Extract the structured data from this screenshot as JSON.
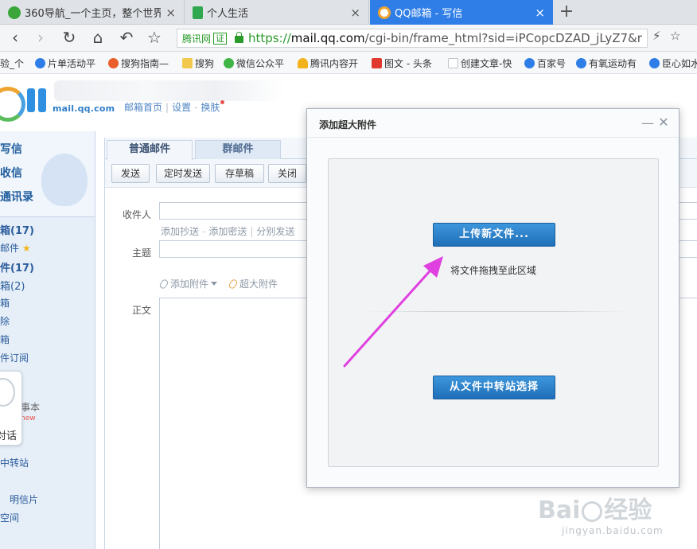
{
  "browser": {
    "tabs": [
      {
        "title": "360导航_一个主页，整个世界",
        "active": false,
        "icon": "360-browser-icon",
        "color": "#3aa53a"
      },
      {
        "title": "个人生活",
        "active": false,
        "icon": "sheet-icon",
        "color": "#2fa84f"
      },
      {
        "title": "QQ邮箱 - 写信",
        "active": true,
        "icon": "qq-mail-icon",
        "color": "#ffffff"
      }
    ],
    "close_glyph": "×",
    "new_tab_glyph": "+",
    "nav": {
      "back": "‹",
      "forward": "›",
      "reload": "↻",
      "home": "⌂",
      "undo": "↶",
      "favorite": "☆"
    },
    "address": {
      "site_tag": "腾讯网",
      "cert_badge": "证",
      "url_scheme": "https://",
      "url_host": "mail.qq.com",
      "url_path": "/cgi-bin/frame_html?sid=iPCopcDZAD_jLyZ7&r"
    },
    "right_icons": {
      "lightning": "⚡",
      "star": "☆"
    },
    "bookmarks": [
      {
        "label": "验_个",
        "icon": "none"
      },
      {
        "label": "片单活动平",
        "icon": "paw-icon",
        "color": "#2f7ee8"
      },
      {
        "label": "搜狗指南—",
        "icon": "sogou-icon",
        "color": "#e85d2a"
      },
      {
        "label": "搜狗",
        "icon": "folder-icon",
        "color": "#f2c94c"
      },
      {
        "label": "微信公众平",
        "icon": "wechat-icon",
        "color": "#3fb545"
      },
      {
        "label": "腾讯内容开",
        "icon": "bell-icon",
        "color": "#f2b21c"
      },
      {
        "label": "图文 - 头条",
        "icon": "toutiao-icon",
        "color": "#e03a2f"
      },
      {
        "label": "创建文章-快",
        "icon": "page-icon",
        "color": "#bfc5cc"
      },
      {
        "label": "百家号",
        "icon": "paw-icon",
        "color": "#2f7ee8"
      },
      {
        "label": "有氧运动有",
        "icon": "paw-icon",
        "color": "#2f7ee8"
      },
      {
        "label": "臣心如水",
        "icon": "paw-icon",
        "color": "#2f7ee8"
      }
    ]
  },
  "mail": {
    "logo_domain": "mail.qq.com",
    "top_links": {
      "home": "邮箱首页",
      "settings": "设置",
      "skin": "换肤"
    },
    "left_nav": {
      "write": "写信",
      "receive": "收信",
      "contacts": "通讯录",
      "inbox": "箱(17)",
      "starred": "邮件",
      "star_glyph": "★",
      "unread": "件(17)",
      "drafts": "箱(2)",
      "sent": "箱",
      "deleted": "除",
      "spam": "箱",
      "subscriptions": "件订阅",
      "notebook": "事本",
      "notebook_tag": "new",
      "chat": "对话",
      "transfer": "中转站",
      "postcard": "明信片",
      "space": "空间"
    },
    "compose": {
      "tabs": [
        "普通邮件",
        "群邮件"
      ],
      "toolbar": [
        "发送",
        "定时发送",
        "存草稿",
        "关闭"
      ],
      "to_label": "收件人",
      "cc_links": {
        "cc": "添加抄送",
        "bcc": "添加密送",
        "separate": "分别发送"
      },
      "subject_label": "主题",
      "attach": {
        "attach": "添加附件",
        "large": "超大附件"
      },
      "body_label": "正文"
    }
  },
  "dialog": {
    "title": "添加超大附件",
    "minimize_glyph": "—",
    "close_glyph": "✕",
    "upload_button": "上传新文件...",
    "drop_hint": "将文件拖拽至此区域",
    "transfer_button": "从文件中转站选择",
    "accent": "#2a7fc9"
  },
  "annotation": {
    "arrow_color": "#e040e0"
  },
  "watermark": {
    "brand_left": "Bai",
    "brand_right": "经验",
    "sub": "jingyan.baidu.com"
  }
}
